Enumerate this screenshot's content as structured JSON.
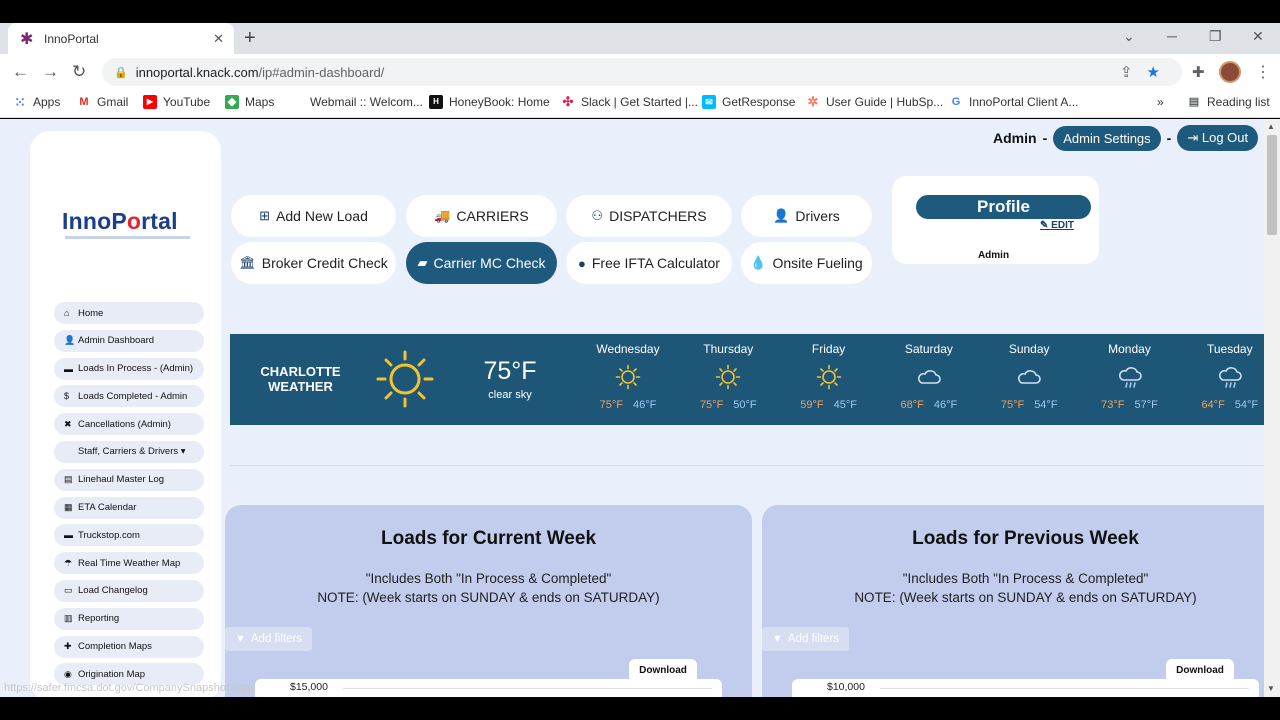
{
  "browser": {
    "tab_title": "InnoPortal",
    "url_host": "innoportal.knack.com",
    "url_path": "/ip#admin-dashboard/",
    "bookmarks": [
      "Apps",
      "Gmail",
      "YouTube",
      "Maps",
      "Webmail :: Welcom...",
      "HoneyBook: Home",
      "Slack | Get Started |...",
      "GetResponse",
      "User Guide | HubSp...",
      "InnoPortal Client A..."
    ],
    "reading_list": "Reading list",
    "status_url": "https://safer.fmcsa.dot.gov/CompanySnapshot.aspx"
  },
  "header": {
    "user": "Admin",
    "sep1": "-",
    "admin_settings": "Admin Settings",
    "sep2": "-",
    "logout": "Log Out"
  },
  "logo": {
    "part1": "InnoP",
    "part2": "o",
    "part3": "rtal"
  },
  "sidebar": {
    "items": [
      {
        "icon": "⌂",
        "label": "Home"
      },
      {
        "icon": "👤",
        "label": "Admin Dashboard"
      },
      {
        "icon": "▬",
        "label": "Loads In Process - (Admin)"
      },
      {
        "icon": "$",
        "label": "Loads Completed - Admin"
      },
      {
        "icon": "✖",
        "label": "Cancellations (Admin)"
      },
      {
        "icon": "",
        "label": "Staff, Carriers & Drivers ▾"
      },
      {
        "icon": "▤",
        "label": "Linehaul Master Log"
      },
      {
        "icon": "▦",
        "label": "ETA Calendar"
      },
      {
        "icon": "▬",
        "label": "Truckstop.com"
      },
      {
        "icon": "☂",
        "label": "Real Time Weather Map"
      },
      {
        "icon": "▭",
        "label": "Load Changelog"
      },
      {
        "icon": "▥",
        "label": "Reporting"
      },
      {
        "icon": "✚",
        "label": "Completion Maps"
      },
      {
        "icon": "◉",
        "label": "Origination Map"
      }
    ]
  },
  "quick_buttons": [
    {
      "icon": "⊞",
      "label": "Add New Load"
    },
    {
      "icon": "🚚",
      "label": "CARRIERS"
    },
    {
      "icon": "⚇",
      "label": "DISPATCHERS"
    },
    {
      "icon": "👤",
      "label": "Drivers"
    },
    {
      "icon": "🏛",
      "label": "Broker Credit Check"
    },
    {
      "icon": "▰",
      "label": "Carrier MC Check"
    },
    {
      "icon": "●",
      "label": "Free IFTA Calculator"
    },
    {
      "icon": "💧",
      "label": "Onsite Fueling"
    }
  ],
  "profile": {
    "title": "Profile",
    "edit": "EDIT",
    "name": "Admin"
  },
  "weather": {
    "city_line1": "CHARLOTTE",
    "city_line2": "WEATHER",
    "current_temp": "75°F",
    "current_cond": "clear sky",
    "days": [
      {
        "name": "Wednesday",
        "icon": "sun",
        "hi": "75°F",
        "lo": "46°F"
      },
      {
        "name": "Thursday",
        "icon": "sun",
        "hi": "75°F",
        "lo": "50°F"
      },
      {
        "name": "Friday",
        "icon": "sun",
        "hi": "59°F",
        "lo": "45°F"
      },
      {
        "name": "Saturday",
        "icon": "cloud",
        "hi": "68°F",
        "lo": "46°F"
      },
      {
        "name": "Sunday",
        "icon": "cloud",
        "hi": "75°F",
        "lo": "54°F"
      },
      {
        "name": "Monday",
        "icon": "rain",
        "hi": "73°F",
        "lo": "57°F"
      },
      {
        "name": "Tuesday",
        "icon": "rain",
        "hi": "64°F",
        "lo": "54°F"
      }
    ]
  },
  "panels": [
    {
      "title": "Loads for Current Week",
      "line1": "\"Includes Both \"In Process & Completed\"",
      "line2": "NOTE: (Week starts on SUNDAY & ends on SATURDAY)",
      "filters": "Add filters",
      "download": "Download",
      "tick": "$15,000"
    },
    {
      "title": "Loads for Previous Week",
      "line1": "\"Includes Both \"In Process & Completed\"",
      "line2": "NOTE: (Week starts on SUNDAY & ends on SATURDAY)",
      "filters": "Add filters",
      "download": "Download",
      "tick": "$10,000"
    }
  ],
  "colors": {
    "accent": "#1d5a7e",
    "weather_bg": "#1e5677",
    "page_bg": "#eaf0fb",
    "panel_bg": "#c2cded"
  }
}
